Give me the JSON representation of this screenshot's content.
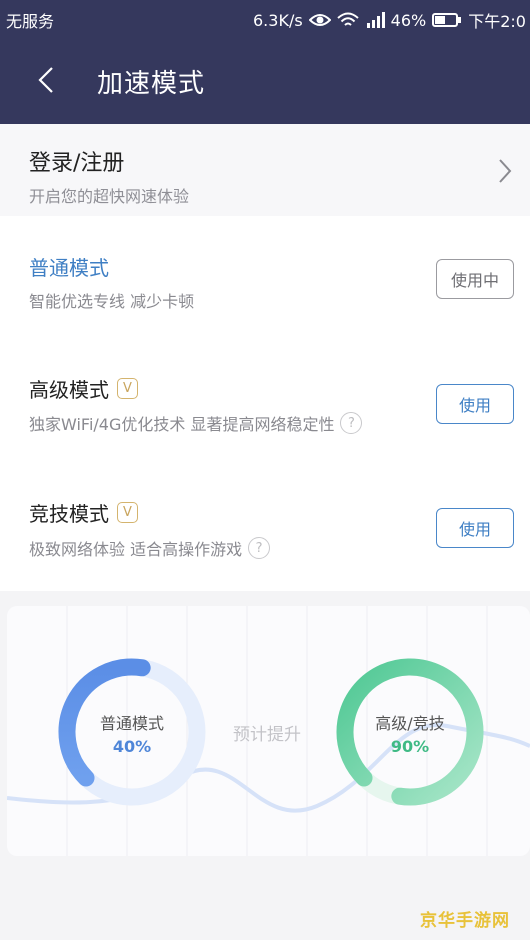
{
  "status_bar": {
    "carrier": "无服务",
    "speed": "6.3K/s",
    "battery": "46%",
    "time": "下午2:0"
  },
  "header": {
    "title": "加速模式"
  },
  "login": {
    "title": "登录/注册",
    "subtitle": "开启您的超快网速体验"
  },
  "modes": [
    {
      "name": "普通模式",
      "desc": "智能优选专线 减少卡顿",
      "button": "使用中",
      "vip": "",
      "help": ""
    },
    {
      "name": "高级模式",
      "desc": "独家WiFi/4G优化技术 显著提高网络稳定性",
      "button": "使用",
      "vip": "V",
      "help": "?"
    },
    {
      "name": "竞技模式",
      "desc": "极致网络体验 适合高操作游戏",
      "button": "使用",
      "vip": "V",
      "help": "?"
    }
  ],
  "comparison": {
    "normal": {
      "label": "普通模式",
      "value": "40%",
      "fraction": 0.4,
      "color": "#5b8ee6"
    },
    "advanced": {
      "label": "高级/竞技",
      "value": "90%",
      "fraction": 0.9,
      "color": "#5fcfa0"
    },
    "middle_label": "预计提升"
  },
  "watermark": "京华手游网",
  "colors": {
    "header_bg": "#35385d",
    "active_mode": "#3f7fc4",
    "vip": "#c9a55e"
  }
}
